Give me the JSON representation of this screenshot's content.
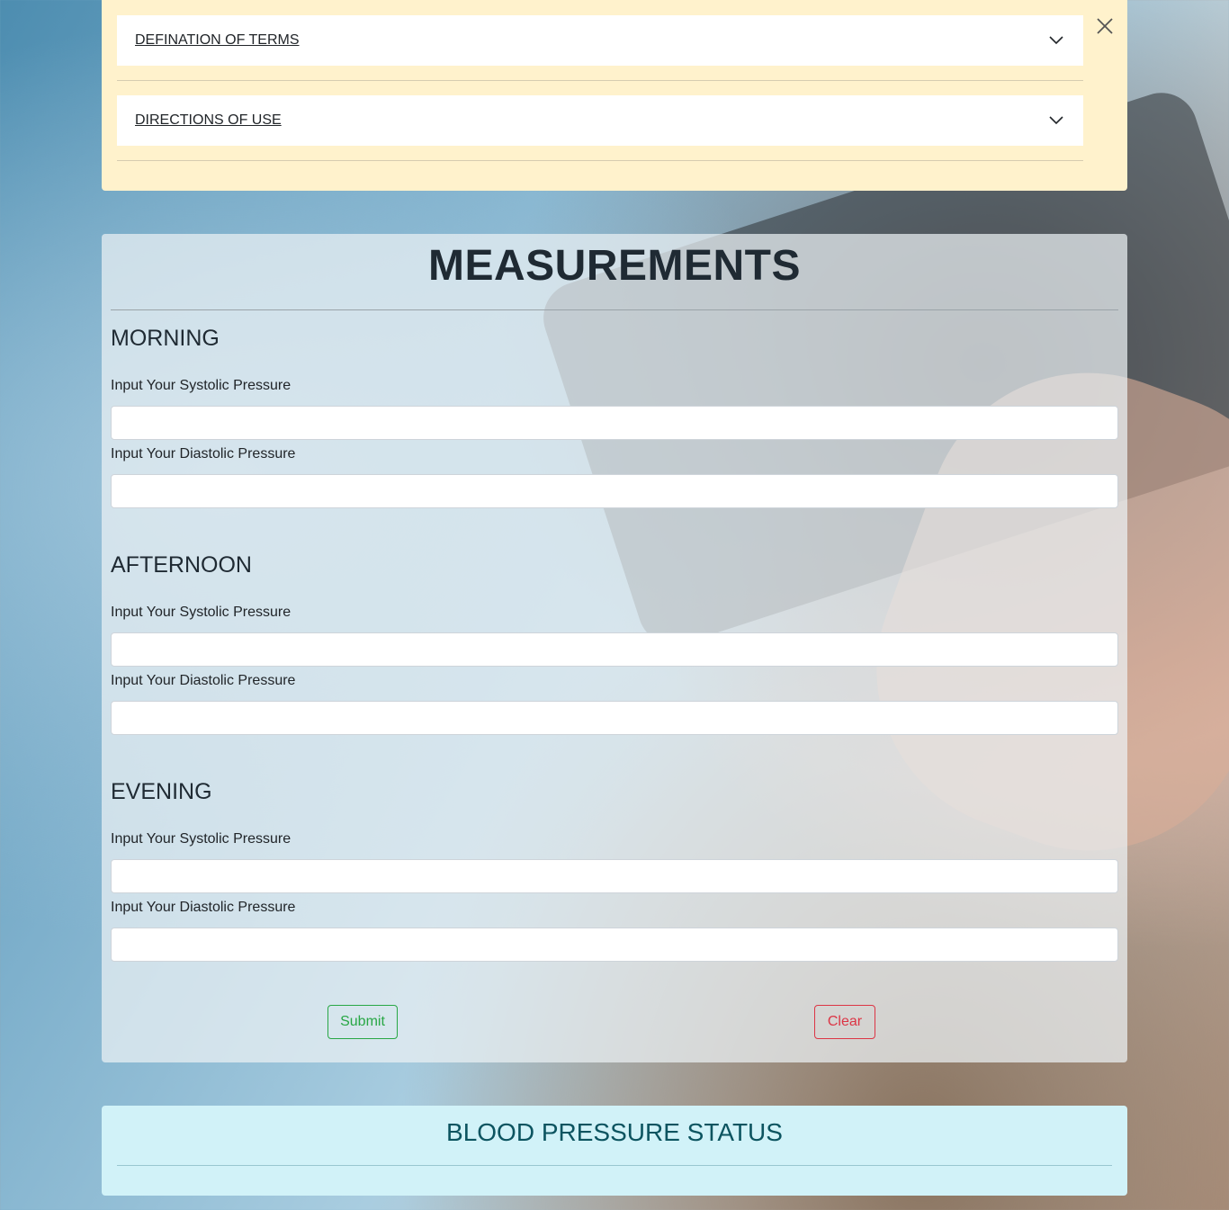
{
  "accordion": {
    "items": [
      {
        "label": "DEFINATION OF TERMS"
      },
      {
        "label": "DIRECTIONS OF USE"
      }
    ]
  },
  "measurements": {
    "title": "MEASUREMENTS",
    "periods": [
      {
        "title": "MORNING",
        "systolic_label": "Input Your Systolic Pressure",
        "diastolic_label": "Input Your Diastolic Pressure",
        "systolic_value": "",
        "diastolic_value": ""
      },
      {
        "title": "AFTERNOON",
        "systolic_label": "Input Your Systolic Pressure",
        "diastolic_label": "Input Your Diastolic Pressure",
        "systolic_value": "",
        "diastolic_value": ""
      },
      {
        "title": "EVENING",
        "systolic_label": "Input Your Systolic Pressure",
        "diastolic_label": "Input Your Diastolic Pressure",
        "systolic_value": "",
        "diastolic_value": ""
      }
    ],
    "submit_label": "Submit",
    "clear_label": "Clear"
  },
  "status": {
    "title": "BLOOD PRESSURE STATUS"
  },
  "icons": {
    "close": "close-icon",
    "expand": "chevron-down-icon"
  },
  "colors": {
    "info_panel_bg": "#fff2cc",
    "status_panel_bg": "#d1f2f8",
    "submit": "#28a745",
    "clear": "#dc3545"
  }
}
